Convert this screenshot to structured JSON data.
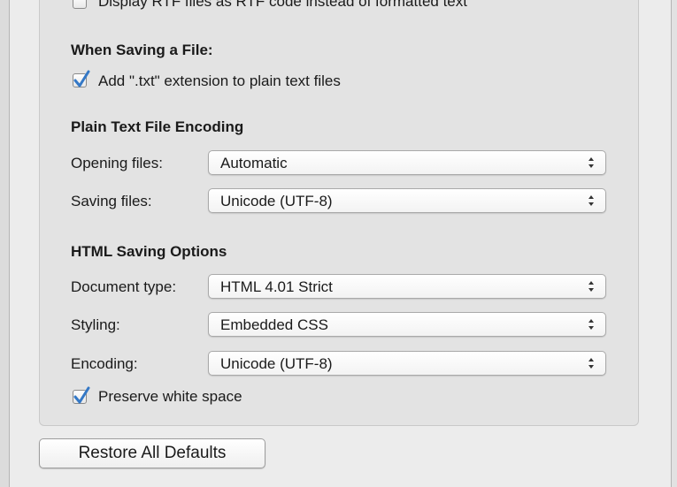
{
  "open": {
    "rtf_code_label": "Display RTF files as RTF code instead of formatted text",
    "rtf_code_checked": false
  },
  "saving": {
    "heading": "When Saving a File:",
    "add_txt_label": "Add \".txt\" extension to plain text files",
    "add_txt_checked": true
  },
  "encoding": {
    "heading": "Plain Text File Encoding",
    "opening_label": "Opening files:",
    "opening_value": "Automatic",
    "saving_label": "Saving files:",
    "saving_value": "Unicode (UTF-8)"
  },
  "html": {
    "heading": "HTML Saving Options",
    "doctype_label": "Document type:",
    "doctype_value": "HTML 4.01 Strict",
    "styling_label": "Styling:",
    "styling_value": "Embedded CSS",
    "encoding_label": "Encoding:",
    "encoding_value": "Unicode (UTF-8)",
    "whitespace_label": "Preserve white space",
    "whitespace_checked": true
  },
  "restore_button": "Restore All Defaults",
  "colors": {
    "check_accent": "#3478c6",
    "panel": "#e3e3e3",
    "window": "#ececec"
  },
  "icons": {
    "checkmark": "checkmark-icon",
    "popup_arrows": "updown-arrows-icon"
  }
}
